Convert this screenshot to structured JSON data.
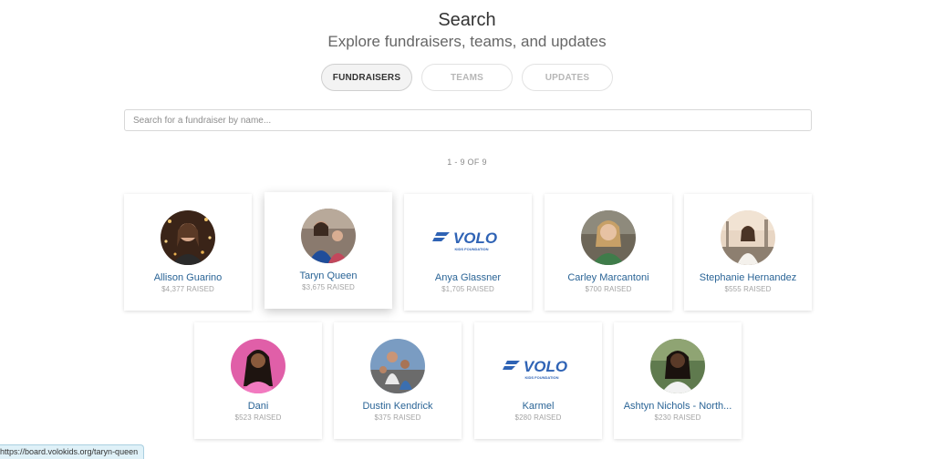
{
  "header": {
    "title": "Search",
    "subtitle": "Explore fundraisers, teams, and updates"
  },
  "tabs": [
    {
      "label": "FUNDRAISERS",
      "active": true
    },
    {
      "label": "TEAMS",
      "active": false
    },
    {
      "label": "UPDATES",
      "active": false
    }
  ],
  "search": {
    "placeholder": "Search for a fundraiser by name...",
    "value": ""
  },
  "results_count": "1 - 9 OF 9",
  "cards": [
    {
      "name": "Allison Guarino",
      "raised": "$4,377 RAISED",
      "image": "avatar-photo"
    },
    {
      "name": "Taryn Queen",
      "raised": "$3,675 RAISED",
      "image": "avatar-photo"
    },
    {
      "name": "Anya Glassner",
      "raised": "$1,705 RAISED",
      "image": "volo-logo"
    },
    {
      "name": "Carley Marcantoni",
      "raised": "$700 RAISED",
      "image": "avatar-photo"
    },
    {
      "name": "Stephanie Hernandez",
      "raised": "$555 RAISED",
      "image": "avatar-photo"
    },
    {
      "name": "Dani",
      "raised": "$523 RAISED",
      "image": "avatar-photo"
    },
    {
      "name": "Dustin Kendrick",
      "raised": "$375 RAISED",
      "image": "avatar-photo"
    },
    {
      "name": "Karmel",
      "raised": "$280 RAISED",
      "image": "volo-logo"
    },
    {
      "name": "Ashtyn Nichols - North...",
      "raised": "$230 RAISED",
      "image": "avatar-photo"
    }
  ],
  "logo": {
    "text": "VOLO",
    "subtext": "KIDS FOUNDATION"
  },
  "status_url": "https://board.volokids.org/taryn-queen",
  "colors": {
    "link": "#2a6496",
    "logo": "#2f63b5",
    "statusbar": "#dff1f8"
  }
}
